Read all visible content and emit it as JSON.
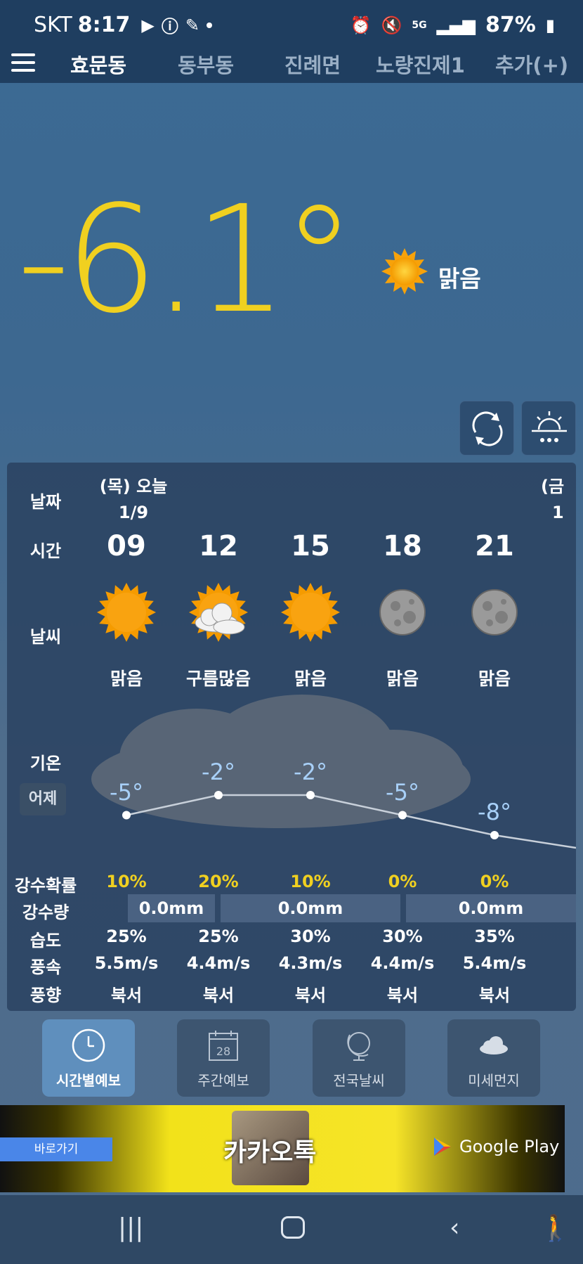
{
  "status": {
    "carrier": "SKT",
    "time": "8:17",
    "network": "5G",
    "battery": "87%"
  },
  "tabs": [
    "효문동",
    "동부동",
    "진례면",
    "노량진제1",
    "추가(+)"
  ],
  "current": {
    "temperature": "-6.1°",
    "condition": "맑음"
  },
  "forecast": {
    "labels": {
      "date": "날짜",
      "time": "시간",
      "weather": "날씨",
      "temp": "기온",
      "yesterday": "어제",
      "precip_prob": "강수확률",
      "precip_amount": "강수량",
      "humidity": "습도",
      "wind_speed": "풍속",
      "wind_dir": "풍향"
    },
    "day1": {
      "weekday": "(목) 오늘",
      "date": "1/9"
    },
    "day2": {
      "weekday": "(금",
      "date": "1"
    },
    "hours": [
      {
        "hour": "09",
        "icon": "sun-icon",
        "cond": "맑음",
        "temp": "-5°",
        "temp_val": -5,
        "prob": "10%",
        "humidity": "25%",
        "wind": "5.5m/s",
        "dir": "북서"
      },
      {
        "hour": "12",
        "icon": "partly-cloudy-icon",
        "cond": "구름많음",
        "temp": "-2°",
        "temp_val": -2,
        "prob": "20%",
        "humidity": "25%",
        "wind": "4.4m/s",
        "dir": "북서"
      },
      {
        "hour": "15",
        "icon": "sun-icon",
        "cond": "맑음",
        "temp": "-2°",
        "temp_val": -2,
        "prob": "10%",
        "humidity": "30%",
        "wind": "4.3m/s",
        "dir": "북서"
      },
      {
        "hour": "18",
        "icon": "moon-icon",
        "cond": "맑음",
        "temp": "-5°",
        "temp_val": -5,
        "prob": "0%",
        "humidity": "30%",
        "wind": "4.4m/s",
        "dir": "북서"
      },
      {
        "hour": "21",
        "icon": "moon-icon",
        "cond": "맑음",
        "temp": "-8°",
        "temp_val": -8,
        "prob": "0%",
        "humidity": "35%",
        "wind": "5.4m/s",
        "dir": "북서"
      }
    ],
    "rain": [
      "0.0mm",
      "0.0mm",
      "0.0mm"
    ]
  },
  "bottom_nav": [
    "시간별예보",
    "주간예보",
    "전국날씨",
    "미세먼지"
  ],
  "calendar_day": "28",
  "ad": {
    "button": "바로가기",
    "title": "카카오톡",
    "store": "Google Play"
  }
}
